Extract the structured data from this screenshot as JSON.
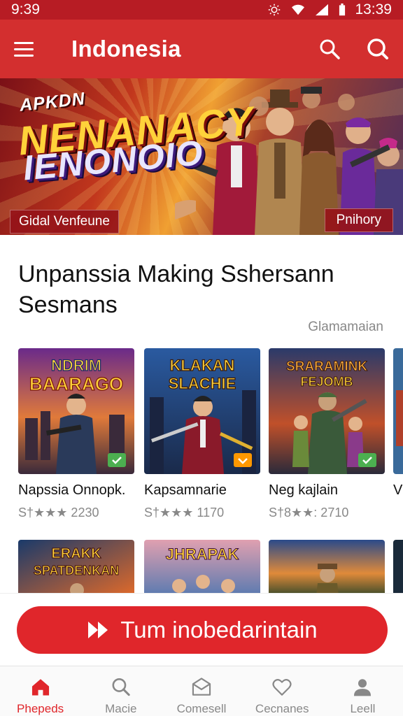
{
  "status_bar": {
    "time": "9:39",
    "time_right": "13:39"
  },
  "app_bar": {
    "title": "Indonesia"
  },
  "banner": {
    "kicker": "APKDN",
    "headline_line1": "NENANACY",
    "headline_line2": "IENONOIO",
    "tag_left": "Gidal Venfeune",
    "tag_right": "Pnihory"
  },
  "section": {
    "title": "Unpanssia Making Sshersann Sesmans",
    "see_all": "Glamamaian"
  },
  "cards": [
    {
      "art_title_1": "NDRIM",
      "art_title_2": "BAARAGO",
      "title": "Napssia Onnopk.",
      "meta": "S†★★★ 2230",
      "check_color": "#4caf50"
    },
    {
      "art_title_1": "KLAKAN",
      "art_title_2": "SLACHIE",
      "title": "Kapsamnarie",
      "meta": "S†★★★ 1170",
      "check_color": "#ff9800"
    },
    {
      "art_title_1": "SRARAMINK",
      "art_title_2": "FEJOMB",
      "title": "Neg kajlain",
      "meta": "S†8★★: 2710",
      "check_color": "#4caf50"
    },
    {
      "title": "V",
      "meta": ""
    }
  ],
  "row2": [
    {
      "art_title_1": "ERAKK",
      "art_title_2": "SPATDENKAN"
    },
    {
      "art_title_1": "JHRAPAK"
    },
    {
      "art_title_1": ""
    }
  ],
  "cta": {
    "label": "Tum inobedarintain"
  },
  "bottom_nav": [
    {
      "label": "Phepeds",
      "icon": "home-icon",
      "active": true
    },
    {
      "label": "Macie",
      "icon": "search-icon",
      "active": false
    },
    {
      "label": "Comesell",
      "icon": "mail-icon",
      "active": false
    },
    {
      "label": "Cecnanes",
      "icon": "heart-icon",
      "active": false
    },
    {
      "label": "Leell",
      "icon": "person-icon",
      "active": false
    }
  ],
  "colors": {
    "primary": "#d32f2f",
    "status_bar": "#b71c24",
    "cta": "#e0262b",
    "active_nav": "#e0262b"
  }
}
